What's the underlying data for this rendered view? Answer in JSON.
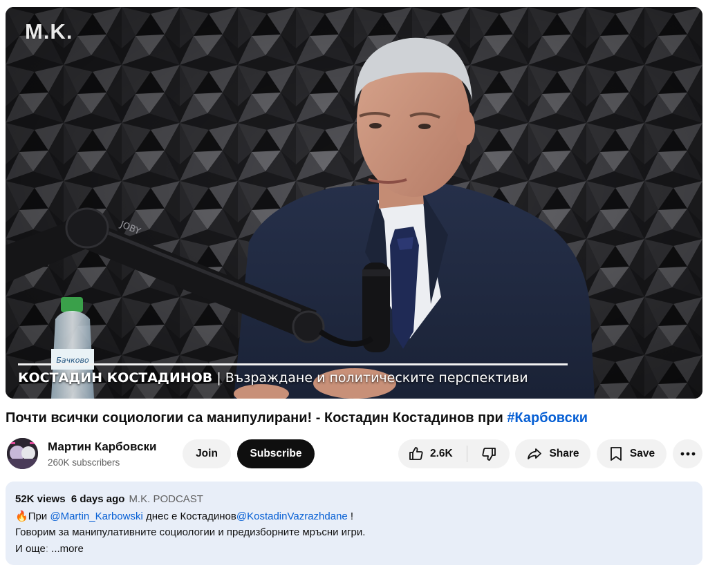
{
  "video": {
    "logo": "M.K.",
    "mic_brand": "JOBY",
    "bottle_label": "Бачково",
    "lower_third_name": "КОСТАДИН КОСТАДИНОВ",
    "lower_third_topic": " | Възраждане и политическите перспективи"
  },
  "title": {
    "text": "Почти всички социологии са манипулирани! - Костадин Костадинов при ",
    "hashtag": "#Карбовски"
  },
  "channel": {
    "name": "Мартин Карбовски",
    "subscribers": "260K subscribers",
    "avatar_icon": "channel-avatar"
  },
  "actions": {
    "join": "Join",
    "subscribe": "Subscribe",
    "likes": "2.6K",
    "share": "Share",
    "save": "Save",
    "more_icon": "more-horizontal-icon"
  },
  "description": {
    "views": "52K views",
    "age": "6 days ago",
    "tag": "M.K. PODCAST",
    "line1_emoji": "🔥",
    "line1_a": "При ",
    "line1_mention1": "@Martin_Karbowski",
    "line1_b": " днес е Костадинов",
    "line1_mention2": "@KostadinVazrazhdane",
    "line1_c": " !",
    "line2": "Говорим за манипулативните социологии и предизборните мръсни игри.",
    "line3_a": "И още",
    "line3_fade": ":",
    "more": " ...more"
  },
  "colors": {
    "link": "#065fd4",
    "subscribe_bg": "#0f0f0f",
    "pill_bg": "#f2f2f2",
    "desc_bg": "#e8eef8"
  }
}
